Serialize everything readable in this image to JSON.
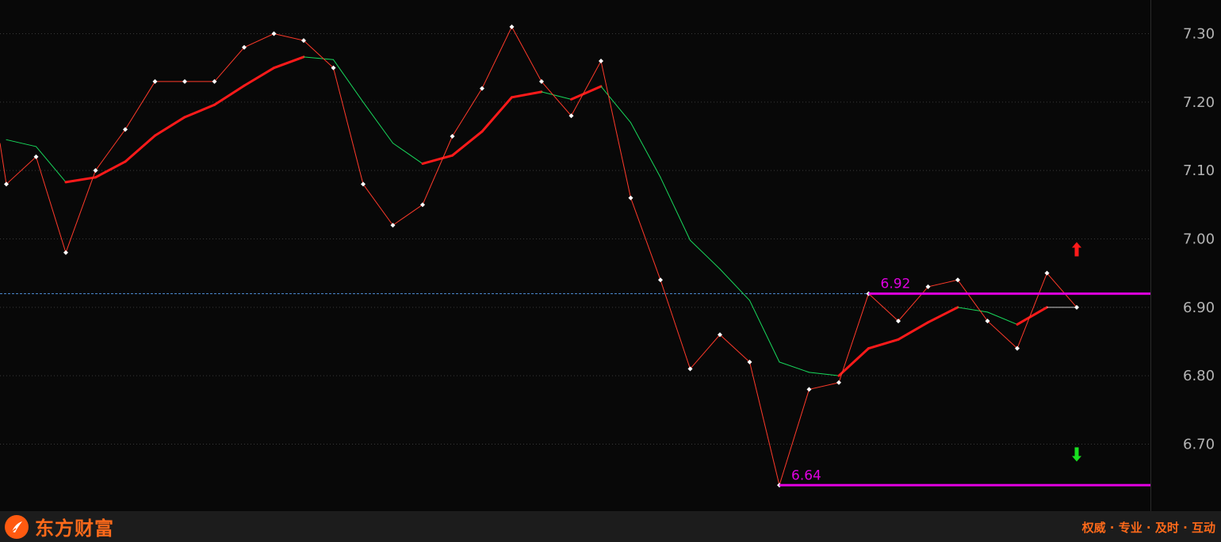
{
  "chart_data": {
    "type": "line",
    "ylim": [
      6.62,
      7.345
    ],
    "y_ticks": [
      "7.30",
      "7.20",
      "7.10",
      "7.00",
      "6.90",
      "6.80",
      "6.70"
    ],
    "grid": true,
    "series": [
      {
        "values": [
          7.08,
          7.12,
          6.98,
          7.1,
          7.16,
          7.23,
          7.23,
          7.23,
          7.28,
          7.3,
          7.29,
          7.25,
          7.08,
          7.02,
          7.05,
          7.15,
          7.22,
          7.31,
          7.23,
          7.18,
          7.26,
          7.06,
          6.94,
          6.81,
          6.86,
          6.82,
          6.64,
          6.78,
          6.79,
          6.92,
          6.88,
          6.93,
          6.94,
          6.88,
          6.84,
          6.95,
          6.9
        ]
      },
      {
        "values": [
          7.145,
          7.135,
          7.083,
          7.09,
          7.113,
          7.151,
          7.178,
          7.196,
          7.224,
          7.25,
          7.266,
          7.262,
          7.2,
          7.14,
          7.11,
          7.122,
          7.157,
          7.207,
          7.215,
          7.204,
          7.223,
          7.17,
          7.09,
          6.998,
          6.956,
          6.91,
          6.82,
          6.805,
          6.8,
          6.84,
          6.853,
          6.878,
          6.9,
          6.893,
          6.875,
          6.9,
          6.9
        ]
      }
    ],
    "ma_up_color": "#ff1a1a",
    "ma_down_color": "#18d85c",
    "ma_flat_color": "#c8c8c8",
    "price_color": "#ff3a2a",
    "reference_line": {
      "value": 6.92,
      "color": "#4f8fd8"
    },
    "annotations": [
      {
        "label": "6.92",
        "value": 6.92,
        "start_index": 29
      },
      {
        "label": "6.64",
        "value": 6.64,
        "start_index": 26
      }
    ],
    "annotation_color": "#e000e0",
    "signals": [
      {
        "type": "up-arrow",
        "color": "#ff1a1a",
        "value": 6.985
      },
      {
        "type": "down-arrow",
        "color": "#18e020",
        "value": 6.685
      }
    ]
  },
  "footer": {
    "brand_name": "东方财富",
    "slogan": "权威 · 专业 · 及时 · 互动",
    "brand_color": "#ff6a1a"
  }
}
